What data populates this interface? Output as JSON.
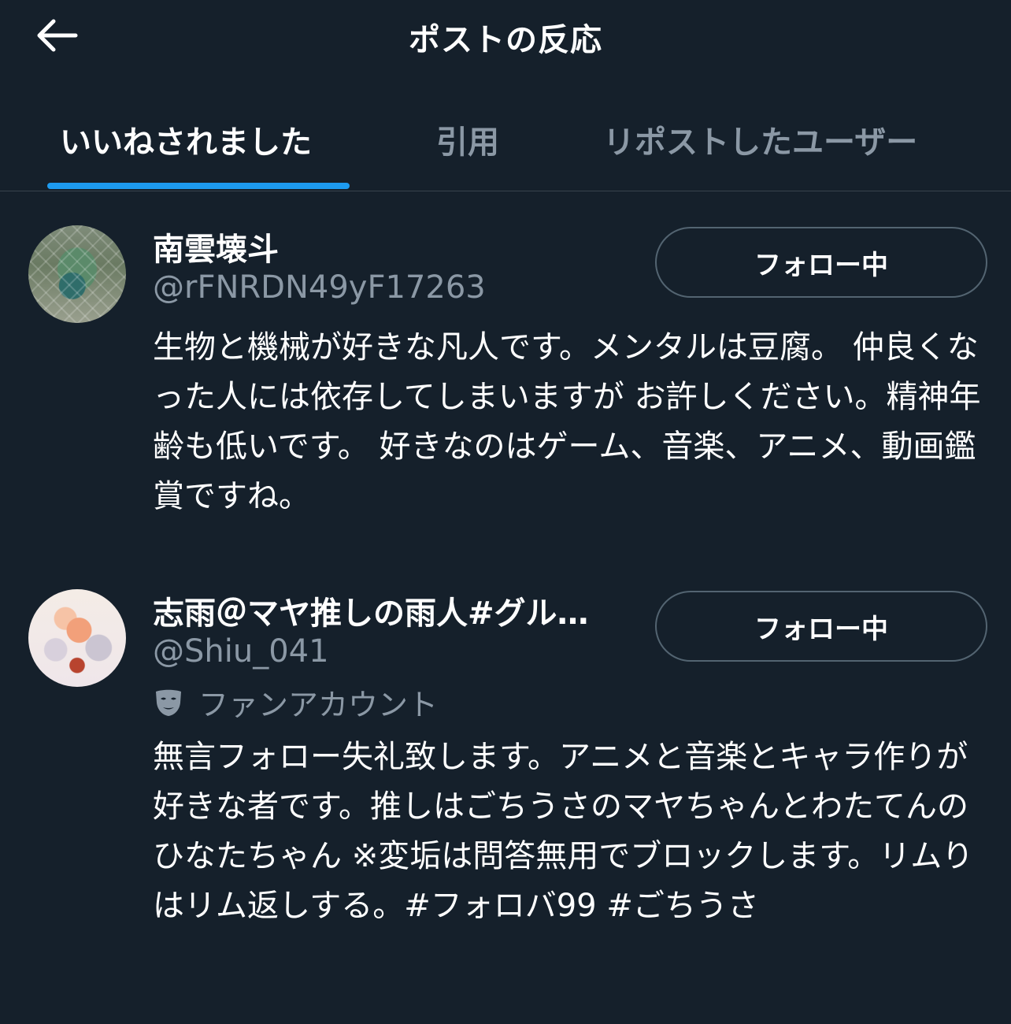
{
  "header": {
    "title": "ポストの反応",
    "back_icon": "arrow-left-icon"
  },
  "tabs": [
    {
      "label": "いいねされました",
      "active": true
    },
    {
      "label": "引用",
      "active": false
    },
    {
      "label": "リポストしたユーザー",
      "active": false
    }
  ],
  "users": [
    {
      "name": "南雲壊斗",
      "handle": "@rFNRDN49yF17263",
      "follow_label": "フォロー中",
      "bio": "生物と機械が好きな凡人です。メンタルは豆腐。 仲良くなった人には依存してしまいますが お許しください。精神年齢も低いです。 好きなのはゲーム、音楽、アニメ、動画鑑賞ですね。"
    },
    {
      "name": "志雨＠マヤ推しの雨人#グル…",
      "handle": "@Shiu_041",
      "label": "ファンアカウント",
      "label_icon": "mask-icon",
      "follow_label": "フォロー中",
      "bio": "無言フォロー失礼致します。アニメと音楽とキャラ作りが好きな者です。推しはごちうさのマヤちゃんとわたてんのひなたちゃん ※変垢は問答無用でブロックします。リムりはリム返しする。#フォロバ99 #ごちうさ"
    }
  ],
  "colors": {
    "background": "#15202b",
    "accent": "#1d9bf0",
    "secondary_text": "#8b98a5",
    "divider": "#38444d"
  }
}
